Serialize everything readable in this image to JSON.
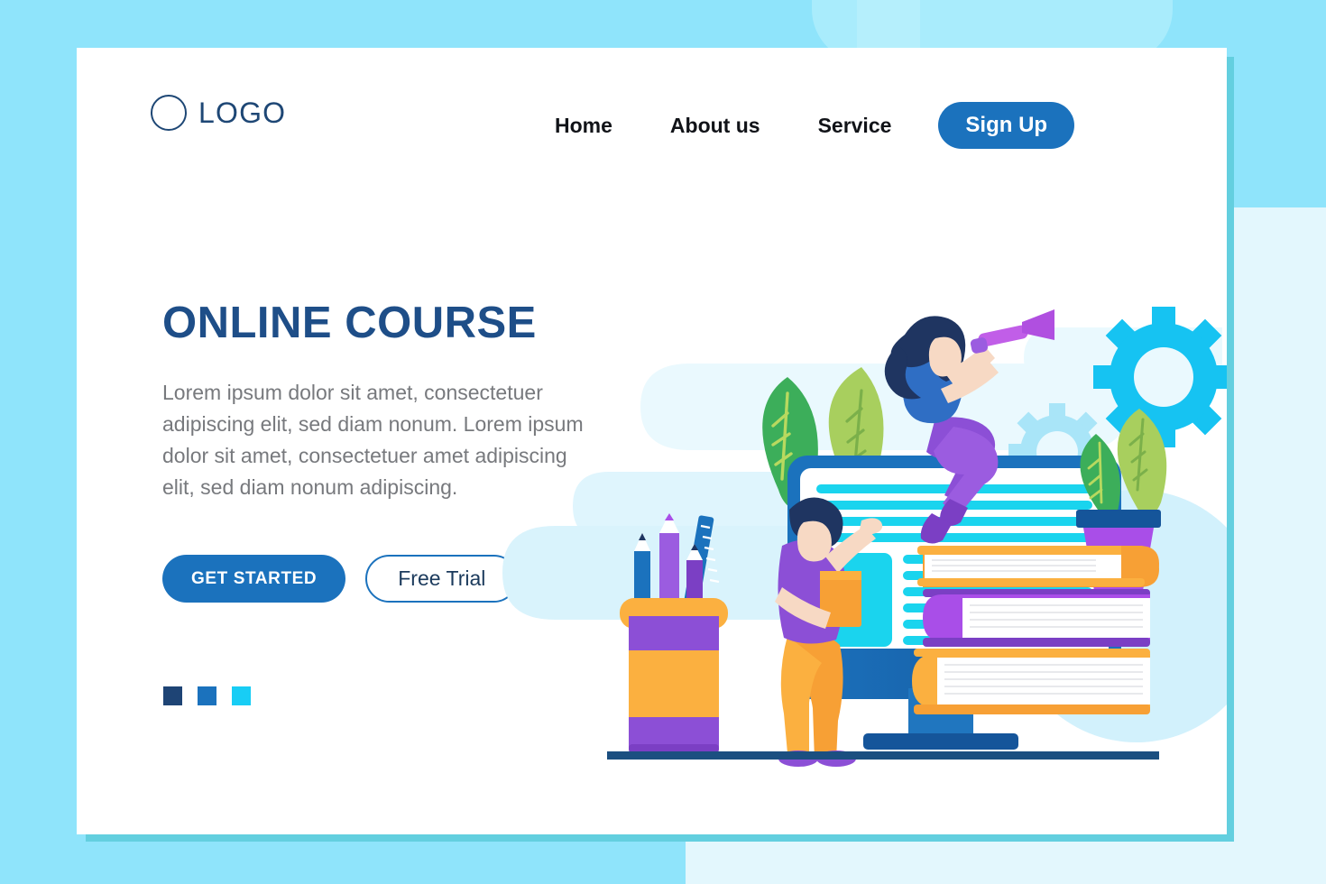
{
  "page": {
    "background_color": "#8fe4fb",
    "card_color": "#ffffff",
    "card_shadow_color": "#63cfdf"
  },
  "header": {
    "logo": {
      "icon": "circle-outline-icon",
      "text": "LOGO",
      "color": "#1e4775"
    },
    "nav_items": [
      {
        "label": "Home"
      },
      {
        "label": "About us"
      },
      {
        "label": "Service"
      }
    ],
    "signup": {
      "label": "Sign Up",
      "background": "#1b72bd",
      "color": "#ffffff"
    }
  },
  "hero": {
    "title": "ONLINE COURSE",
    "title_color": "#1e4e88",
    "description": "Lorem ipsum dolor sit amet, consectetuer adipiscing elit, sed diam nonum. Lorem ipsum dolor sit amet, consectetuer amet adipiscing elit, sed diam nonum adipiscing.",
    "description_color": "#77797d",
    "primary_cta": {
      "label": "GET STARTED",
      "background": "#1b72bd",
      "color": "#ffffff"
    },
    "secondary_cta": {
      "label": "Free Trial",
      "border": "#1b72bd",
      "color": "#1b3a5c"
    },
    "carousel_dots": [
      {
        "name": "dot-1",
        "color": "#1e4475",
        "active": true
      },
      {
        "name": "dot-2",
        "color": "#1b72bd",
        "active": false
      },
      {
        "name": "dot-3",
        "color": "#18cdf5",
        "active": false
      }
    ]
  },
  "illustration": {
    "name": "online-course-illustration",
    "elements": [
      "monitor",
      "screen-text-lines",
      "screen-image-block",
      "woman-with-telescope",
      "man-with-book",
      "book-stack",
      "potted-plant",
      "leaves",
      "pencil-cup",
      "gear-large",
      "gear-small",
      "desk-line"
    ],
    "colors": {
      "monitor_frame": "#1b72bd",
      "monitor_frame_dark": "#15559a",
      "screen_line": "#1ad4ee",
      "screen_block": "#1ad4ee",
      "book_orange": "#f7a035",
      "book_purple": "#a94ee8",
      "purple": "#8c4fd6",
      "orange": "#f7a035",
      "green_dark": "#3cae5a",
      "green_light": "#a8cf5e",
      "gear_bright": "#16c3f2",
      "gear_pale": "#a9e5f8",
      "hair_navy": "#1f3561",
      "skin": "#f7d9c4",
      "cloud": "#d8f3fc"
    }
  }
}
